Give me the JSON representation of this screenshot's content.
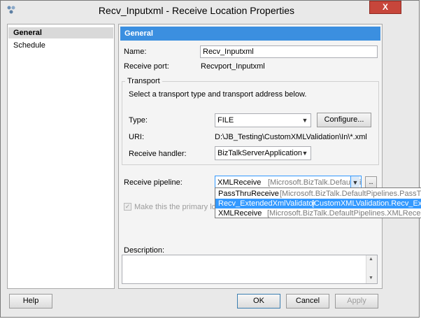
{
  "window": {
    "title": "Recv_Inputxml - Receive Location Properties",
    "close_label": "X"
  },
  "nav": {
    "items": [
      {
        "label": "General",
        "selected": true
      },
      {
        "label": "Schedule",
        "selected": false
      }
    ]
  },
  "general": {
    "header": "General",
    "name_label": "Name:",
    "name_value": "Recv_Inputxml",
    "receive_port_label": "Receive port:",
    "receive_port_value": "Recvport_Inputxml",
    "transport": {
      "legend": "Transport",
      "instruction": "Select a transport type and transport address below.",
      "type_label": "Type:",
      "type_value": "FILE",
      "configure_label": "Configure...",
      "uri_label": "URI:",
      "uri_value": "D:\\JB_Testing\\CustomXMLValidation\\In\\*.xml",
      "handler_label": "Receive handler:",
      "handler_value": "BizTalkServerApplication"
    },
    "pipeline": {
      "label": "Receive pipeline:",
      "selected_name": "XMLReceive",
      "selected_assembly": "[Microsoft.BizTalk.DefaultPip",
      "browse_label": "..",
      "options": [
        {
          "name": "PassThruReceive",
          "assembly": "[Microsoft.BizTalk.DefaultPipelines.PassThruRece",
          "highlighted": false
        },
        {
          "name": "Recv_ExtendedXmlValidator",
          "assembly": "[CustomXMLValidation.Recv_Extended",
          "highlighted": true
        },
        {
          "name": "XMLReceive",
          "assembly": "[Microsoft.BizTalk.DefaultPipelines.XMLReceive, Micro",
          "highlighted": false
        }
      ]
    },
    "primary_location_label": "Make this the primary location",
    "description_label": "Description:",
    "description_value": ""
  },
  "footer": {
    "help_label": "Help",
    "ok_label": "OK",
    "cancel_label": "Cancel",
    "apply_label": "Apply"
  },
  "colors": {
    "header_bar": "#3b8fe0",
    "selection": "#3399ff",
    "close_button": "#c7463b"
  }
}
